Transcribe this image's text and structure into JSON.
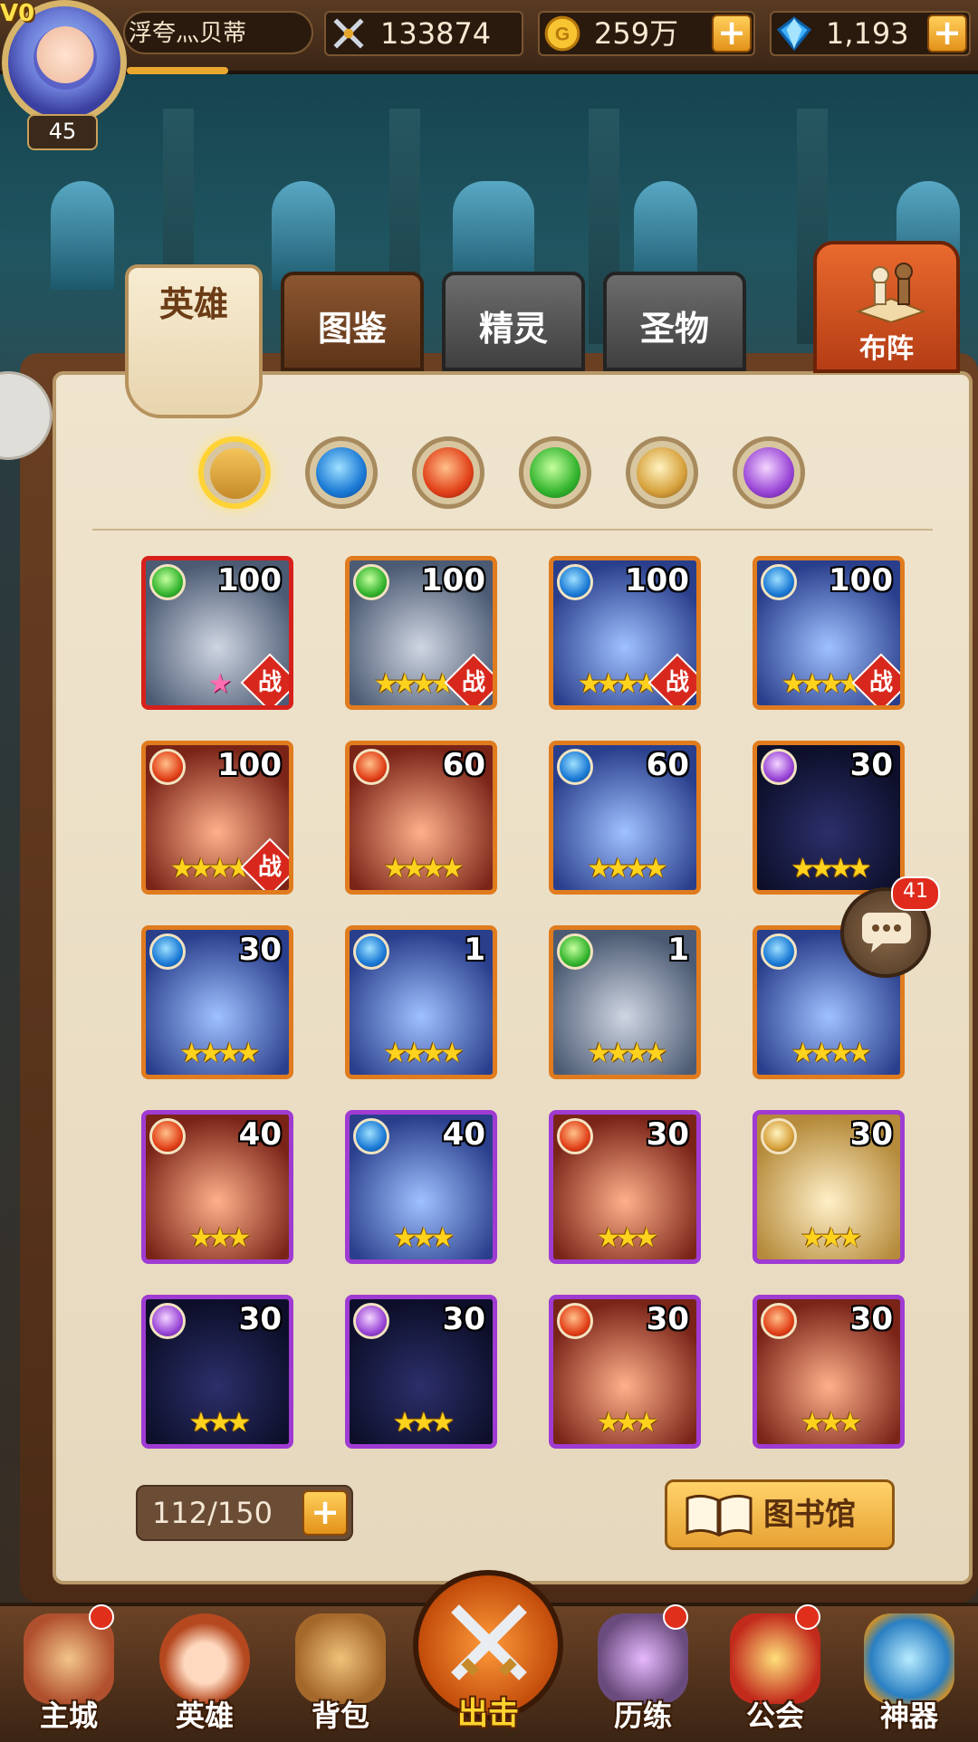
{
  "player": {
    "vip": "V0",
    "name": "浮夸灬贝蒂",
    "level": "45"
  },
  "resources": {
    "power": "133874",
    "gold": "259万",
    "gems": "1,193"
  },
  "tabs": [
    {
      "label": "英雄",
      "active": true
    },
    {
      "label": "图鉴",
      "active": false
    },
    {
      "label": "精灵",
      "active": false
    },
    {
      "label": "圣物",
      "active": false
    }
  ],
  "formation_label": "布阵",
  "filters": [
    {
      "name": "all",
      "active": true
    },
    {
      "name": "water"
    },
    {
      "name": "fire"
    },
    {
      "name": "wind"
    },
    {
      "name": "light"
    },
    {
      "name": "dark"
    }
  ],
  "heroes": [
    {
      "element": "wind",
      "level": "100",
      "stars": "★",
      "star_color": "pink",
      "frame": "red",
      "in_battle": true
    },
    {
      "element": "wind",
      "level": "100",
      "stars": "★★★★★",
      "frame": "orange",
      "in_battle": true
    },
    {
      "element": "water",
      "level": "100",
      "stars": "★★★★★",
      "frame": "orange",
      "in_battle": true
    },
    {
      "element": "water",
      "level": "100",
      "stars": "★★★★★",
      "frame": "orange",
      "in_battle": true
    },
    {
      "element": "fire",
      "level": "100",
      "stars": "★★★★★",
      "frame": "orange",
      "in_battle": true
    },
    {
      "element": "fire",
      "level": "60",
      "stars": "★★★★",
      "frame": "orange",
      "in_battle": false
    },
    {
      "element": "water",
      "level": "60",
      "stars": "★★★★",
      "frame": "orange",
      "in_battle": false
    },
    {
      "element": "dark",
      "level": "30",
      "stars": "★★★★",
      "frame": "orange",
      "in_battle": false
    },
    {
      "element": "water",
      "level": "30",
      "stars": "★★★★",
      "frame": "orange",
      "in_battle": false
    },
    {
      "element": "water",
      "level": "1",
      "stars": "★★★★",
      "frame": "orange",
      "in_battle": false
    },
    {
      "element": "wind",
      "level": "1",
      "stars": "★★★★",
      "frame": "orange",
      "in_battle": false
    },
    {
      "element": "water",
      "level": "",
      "stars": "★★★★",
      "frame": "orange",
      "in_battle": false
    },
    {
      "element": "fire",
      "level": "40",
      "stars": "★★★",
      "frame": "purple",
      "in_battle": false
    },
    {
      "element": "water",
      "level": "40",
      "stars": "★★★",
      "frame": "purple",
      "in_battle": false
    },
    {
      "element": "fire",
      "level": "30",
      "stars": "★★★",
      "frame": "purple",
      "in_battle": false
    },
    {
      "element": "light",
      "level": "30",
      "stars": "★★★",
      "frame": "purple",
      "in_battle": false
    },
    {
      "element": "dark",
      "level": "30",
      "stars": "★★★",
      "frame": "purple",
      "in_battle": false
    },
    {
      "element": "dark",
      "level": "30",
      "stars": "★★★",
      "frame": "purple",
      "in_battle": false
    },
    {
      "element": "fire",
      "level": "30",
      "stars": "★★★",
      "frame": "purple",
      "in_battle": false
    },
    {
      "element": "fire",
      "level": "30",
      "stars": "★★★",
      "frame": "purple",
      "in_battle": false
    }
  ],
  "battle_badge": "战",
  "capacity": "112/150",
  "library_label": "图书馆",
  "chat_badge": "41",
  "nav": [
    {
      "label": "主城",
      "dot": true
    },
    {
      "label": "英雄",
      "dot": false
    },
    {
      "label": "背包",
      "dot": false
    },
    {
      "label": "出击",
      "dot": false
    },
    {
      "label": "历练",
      "dot": true
    },
    {
      "label": "公会",
      "dot": true
    },
    {
      "label": "神器",
      "dot": false
    }
  ]
}
